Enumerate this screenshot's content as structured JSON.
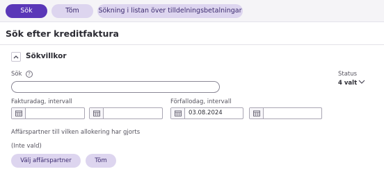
{
  "toolbar": {
    "search_label": "Sök",
    "clear_label": "Töm",
    "search_in_list_label": "Sökning i listan över tilldelningsbetalningar"
  },
  "page": {
    "title": "Sök efter kreditfaktura"
  },
  "criteria": {
    "section_title": "Sökvillkor",
    "search_label": "Sök",
    "search_value": "",
    "status_label": "Status",
    "status_value": "4 valt",
    "invoice_date_label": "Fakturadag, intervall",
    "invoice_date_from": "",
    "invoice_date_to": "",
    "due_date_label": "Förfallodag, intervall",
    "due_date_from": "03.08.2024",
    "due_date_to": "",
    "partner_label": "Affärspartner till vilken allokering har gjorts",
    "partner_value": "(Inte vald)",
    "choose_partner_label": "Välj affärspartner",
    "clear_partner_label": "Töm"
  },
  "icons": {
    "help": "help-icon",
    "calendar": "calendar-icon",
    "collapse": "chevron-up-icon",
    "dropdown": "chevron-down-icon"
  },
  "colors": {
    "primary": "#5a37b8",
    "secondary_pill": "#ddd5ef",
    "toolbar_bg": "#f5f4f7"
  }
}
